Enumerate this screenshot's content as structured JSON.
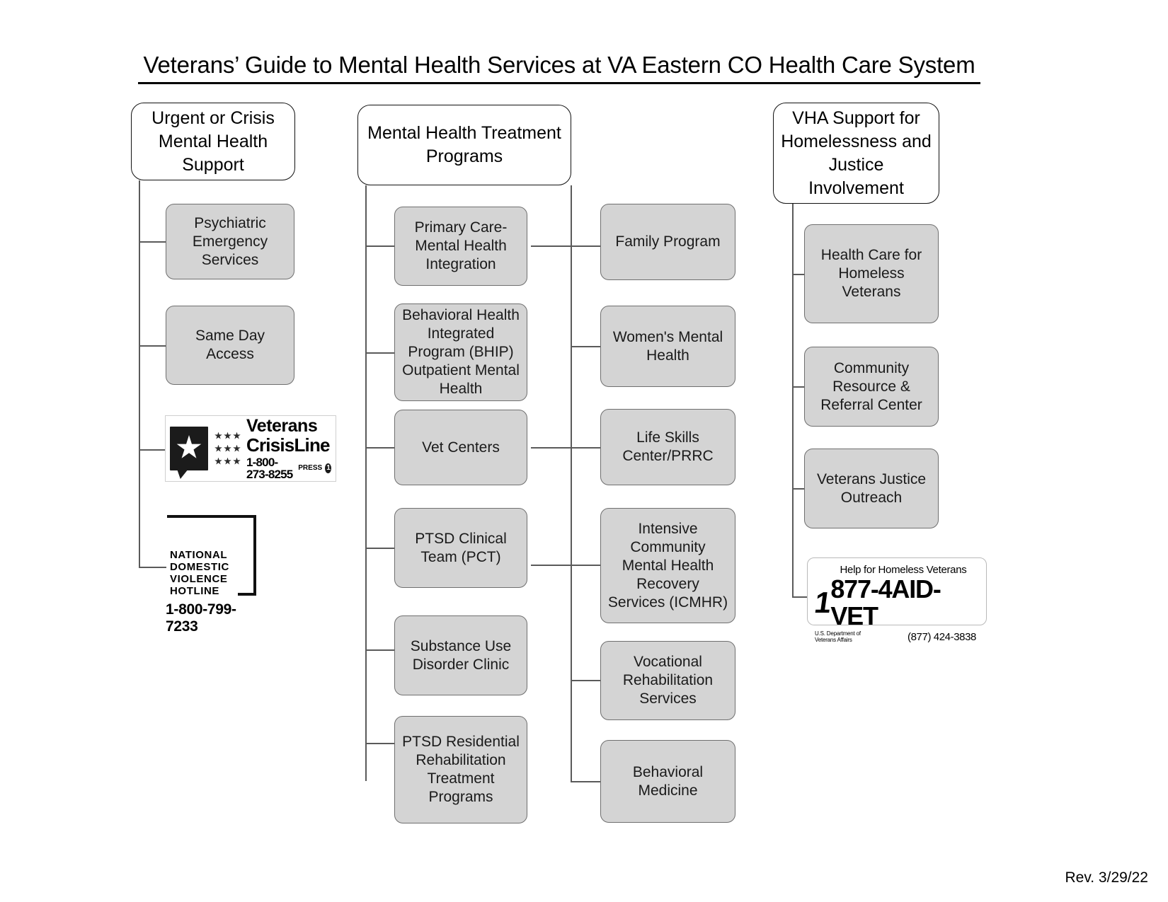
{
  "document": {
    "title": "Veterans’ Guide to Mental Health Services at VA Eastern CO Health Care System",
    "revision": "Rev. 3/29/22"
  },
  "columns": {
    "urgent": {
      "header": "Urgent or Crisis Mental Health Support",
      "items": [
        {
          "label": "Psychiatric Emergency Services"
        },
        {
          "label": "Same Day Access"
        }
      ]
    },
    "treatment": {
      "header": "Mental Health Treatment Programs",
      "items_left": [
        {
          "label": "Primary Care-Mental Health Integration"
        },
        {
          "label": "Behavioral Health Integrated Program (BHIP) Outpatient Mental Health"
        },
        {
          "label": "Vet Centers"
        },
        {
          "label": "PTSD Clinical Team (PCT)"
        },
        {
          "label": "Substance Use Disorder Clinic"
        },
        {
          "label": "PTSD Residential Rehabilitation Treatment Programs"
        }
      ],
      "items_right": [
        {
          "label": "Family Program"
        },
        {
          "label": "Women's Mental Health"
        },
        {
          "label": "Life Skills Center/PRRC"
        },
        {
          "label": "Intensive Community Mental Health Recovery Services (ICMHR)"
        },
        {
          "label": "Vocational Rehabilitation Services"
        },
        {
          "label": "Behavioral Medicine"
        }
      ]
    },
    "vha": {
      "header": "VHA Support for Homelessness and Justice Involvement",
      "items": [
        {
          "label": "Health Care for Homeless Veterans"
        },
        {
          "label": "Community Resource & Referral Center"
        },
        {
          "label": "Veterans Justice Outreach"
        }
      ]
    }
  },
  "logos": {
    "veterans_crisis_line": {
      "line1": "Veterans",
      "line2": "CrisisLine",
      "phone": "1-800-273-8255",
      "press_label": "PRESS",
      "press_digit": "1"
    },
    "national_domestic_violence_hotline": {
      "name": "NATIONAL\nDOMESTIC\nVIOLENCE\nHOTLINE",
      "phone": "1-800-799-7233"
    },
    "help_for_homeless_veterans": {
      "tagline": "Help for Homeless Veterans",
      "prefix": "1",
      "phone": "877-4AID-VET",
      "small_print": "U.S. Department of Veterans Affairs",
      "alt_phone": "(877) 424-3838"
    }
  },
  "colors": {
    "child_box_fill": "#d4d4d4",
    "line": "#5a5a5a",
    "text": "#000000"
  }
}
